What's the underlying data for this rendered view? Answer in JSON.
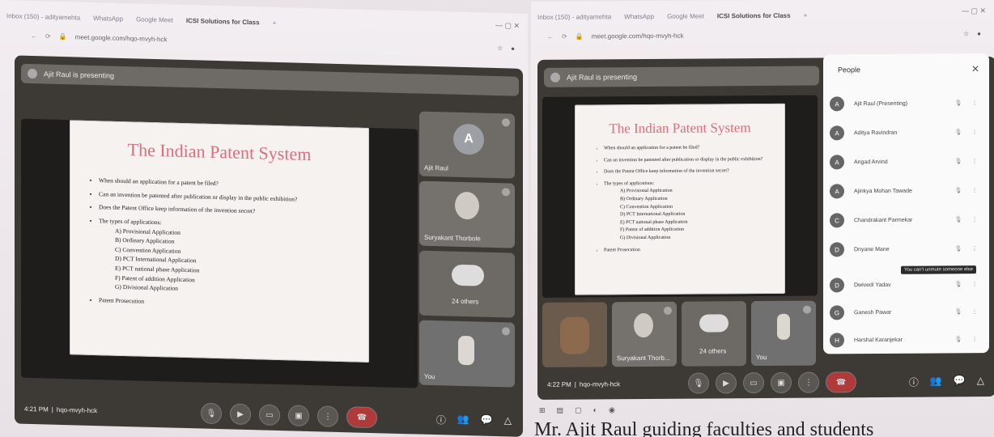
{
  "left": {
    "tabs": [
      "Inbox (150) - adityamehta",
      "WhatsApp",
      "Google Meet",
      "ICSI Solutions for Class",
      "+"
    ],
    "address": "meet.google.com/hqo-mvyh-hck",
    "presenting": "Ajit Raul is presenting",
    "slide": {
      "title": "The Indian Patent System",
      "bullets": [
        "When should an application for a patent be filed?",
        "Can an invention be patented after publication or display in the public exhibition?",
        "Does the Patent Office keep information of the invention secret?",
        "The types of applications:",
        "Patent Prosecution"
      ],
      "sub_items": [
        "A) Provisional Application",
        "B) Ordinary Application",
        "C) Convention Application",
        "D) PCT International Application",
        "E) PCT national phase Application",
        "F) Patent of addition Application",
        "G) Divisional Application"
      ]
    },
    "tiles": [
      {
        "name": "Ajit Raul",
        "initial": "A"
      },
      {
        "name": "Suryakant Thorbole"
      },
      {
        "name": "24 others"
      },
      {
        "name": "You"
      }
    ],
    "time": "4:21 PM",
    "meeting_code": "hqo-mvyh-hck"
  },
  "right": {
    "tabs": [
      "Inbox (150) - adityamehta",
      "WhatsApp",
      "Google Meet",
      "ICSI Solutions for Class",
      "+"
    ],
    "address": "meet.google.com/hqo-mvyh-hck",
    "presenting": "Ajit Raul is presenting",
    "slide": {
      "title": "The Indian Patent System",
      "bullets": [
        "When should an application for a patent be filed?",
        "Can an invention be patented after publication or display in the public exhibition?",
        "Does the Patent Office keep information of the invention secret?",
        "The types of applications:",
        "Patent Prosecution"
      ],
      "sub_items": [
        "A) Provisional Application",
        "B) Ordinary Application",
        "C) Convention Application",
        "D) PCT International Application",
        "E) PCT national phase Application",
        "F) Patent of addition Application",
        "G) Divisional Application"
      ]
    },
    "tiles": [
      {
        "name": ""
      },
      {
        "name": "Suryakant Thorb..."
      },
      {
        "name": "24 others"
      },
      {
        "name": "You"
      }
    ],
    "people": {
      "header": "People",
      "rows": [
        {
          "name": "Ajit Raul (Presenting)",
          "initial": "A"
        },
        {
          "name": "Aditya Ravindran",
          "initial": "A"
        },
        {
          "name": "Angad Arvind",
          "initial": "A"
        },
        {
          "name": "Ajinkya Mohan Tawade",
          "initial": "A"
        },
        {
          "name": "Chandrakant Parmekar",
          "initial": "C"
        },
        {
          "name": "Dnyane Mane",
          "initial": "D"
        },
        {
          "name": "Dwivedi Yadav",
          "initial": "D"
        },
        {
          "name": "Ganesh Pawar",
          "initial": "G"
        },
        {
          "name": "Harshal Karanjekar",
          "initial": "H"
        }
      ],
      "tooltip": "You can't unmute someone else"
    },
    "time": "4:22 PM",
    "meeting_code": "hqo-mvyh-hck"
  },
  "caption": "Mr. Ajit Raul guiding faculties and students"
}
